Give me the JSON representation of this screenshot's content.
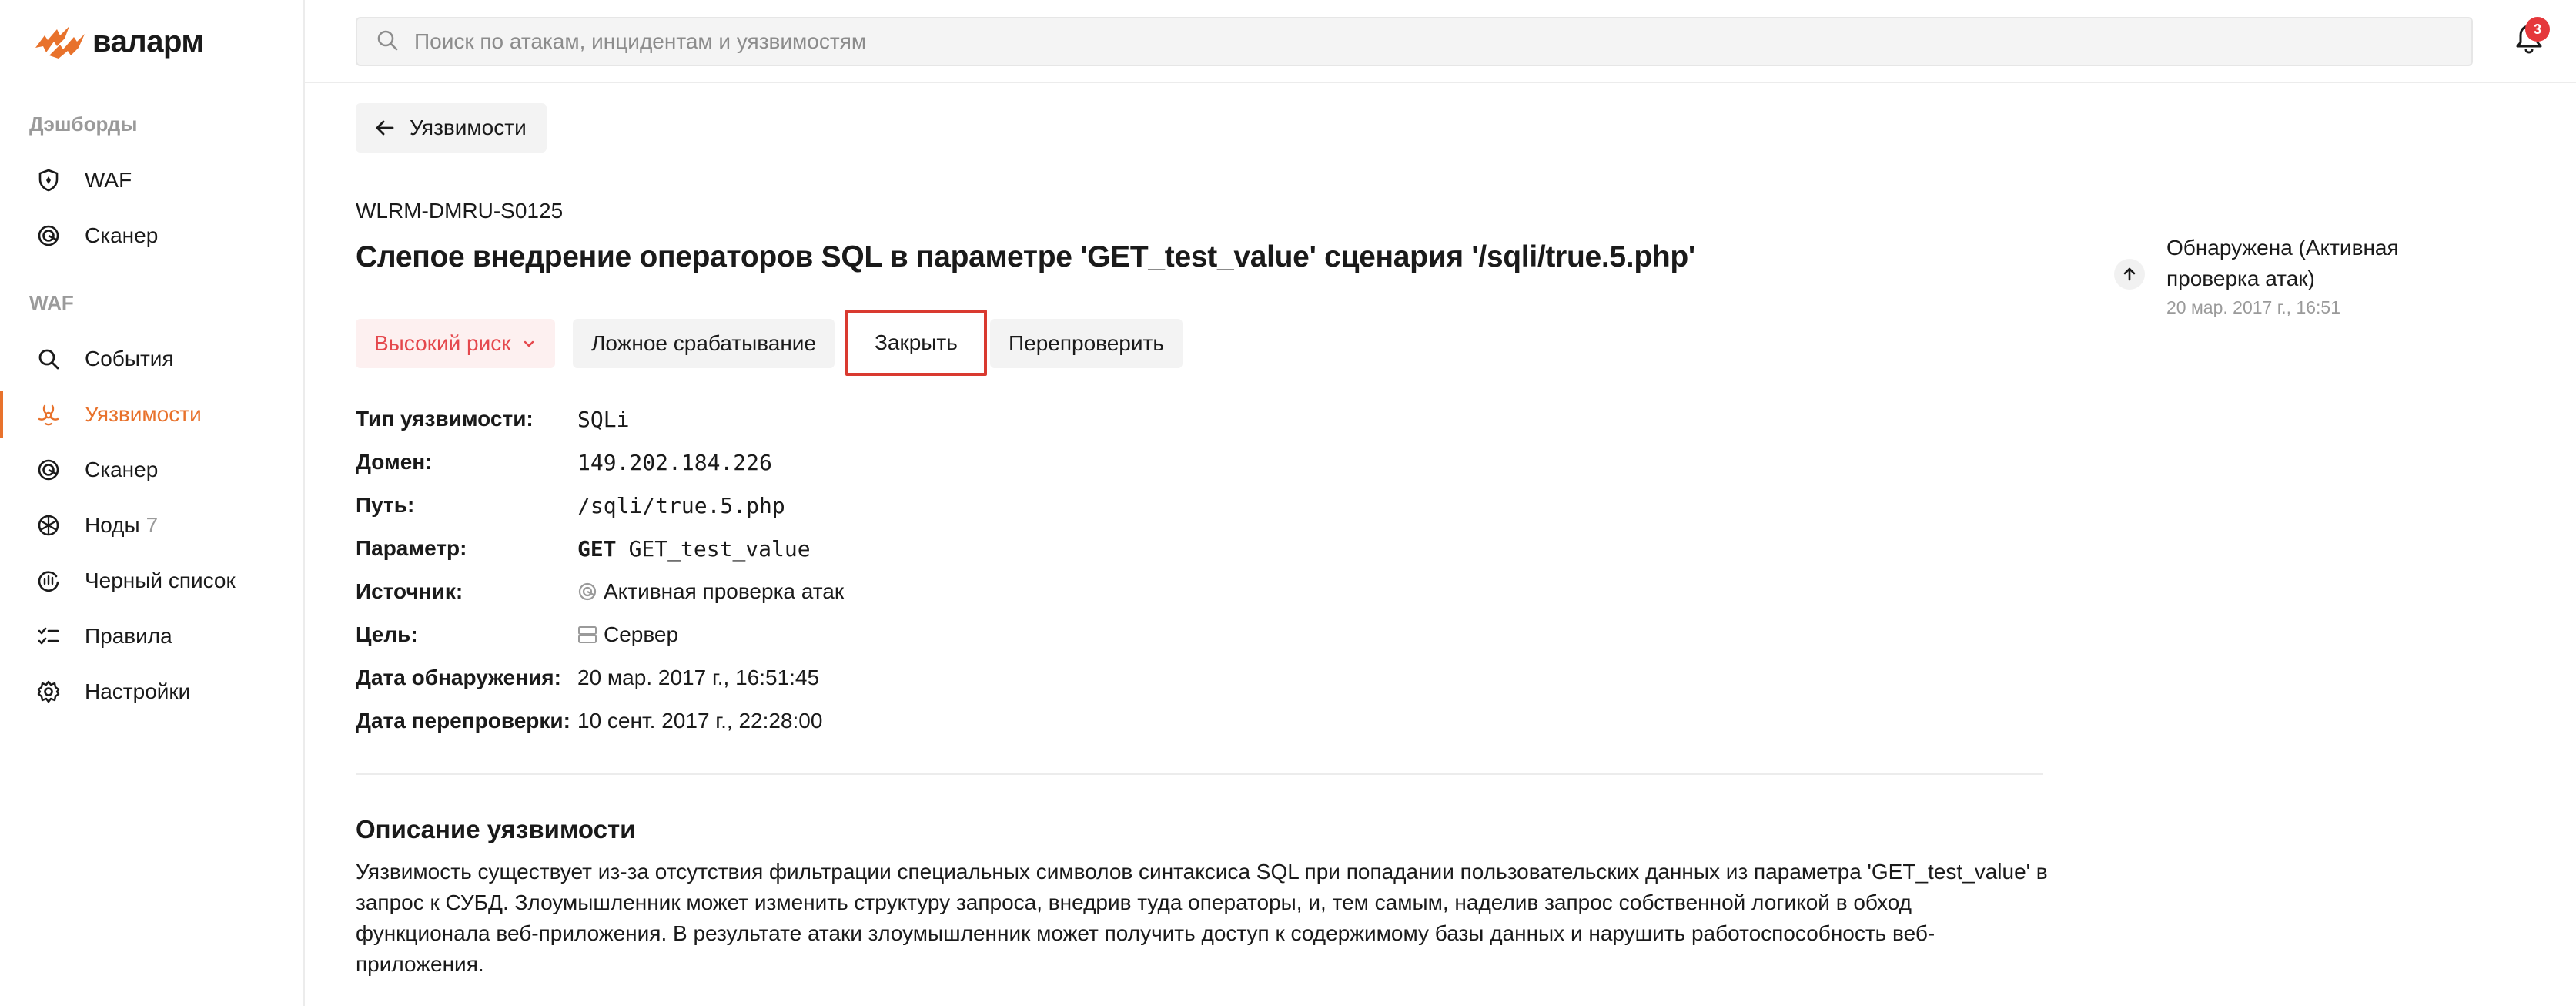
{
  "logo": {
    "text": "валарм"
  },
  "search": {
    "placeholder": "Поиск по атакам, инцидентам и уязвимостям"
  },
  "notifications": {
    "count": "3"
  },
  "sidebar": {
    "sections": [
      {
        "title": "Дэшборды"
      },
      {
        "title": "WAF"
      }
    ],
    "dashboards": [
      {
        "label": "WAF",
        "icon": "shield-icon"
      },
      {
        "label": "Сканер",
        "icon": "scanner-icon"
      }
    ],
    "waf": [
      {
        "label": "События",
        "icon": "search-icon"
      },
      {
        "label": "Уязвимости",
        "icon": "biohazard-icon",
        "active": true
      },
      {
        "label": "Сканер",
        "icon": "scanner-icon"
      },
      {
        "label": "Ноды",
        "icon": "nodes-icon",
        "count": "7"
      },
      {
        "label": "Черный список",
        "icon": "blacklist-icon"
      },
      {
        "label": "Правила",
        "icon": "rules-icon"
      },
      {
        "label": "Настройки",
        "icon": "gear-icon"
      }
    ]
  },
  "main": {
    "back_label": "Уязвимости",
    "vuln_id": "WLRM-DMRU-S0125",
    "title": "Слепое внедрение операторов SQL в параметре 'GET_test_value' сценария '/sqli/true.5.php'",
    "actions": {
      "risk": "Высокий риск",
      "false_positive": "Ложное срабатывание",
      "close": "Закрыть",
      "recheck": "Перепроверить"
    },
    "details": {
      "type_label": "Тип уязвимости:",
      "type_value": "SQLi",
      "domain_label": "Домен:",
      "domain_value": "149.202.184.226",
      "path_label": "Путь:",
      "path_value": "/sqli/true.5.php",
      "param_label": "Параметр:",
      "param_method": "GET",
      "param_value": "GET_test_value",
      "source_label": "Источник:",
      "source_value": "Активная проверка атак",
      "target_label": "Цель:",
      "target_value": "Сервер",
      "found_label": "Дата обнаружения:",
      "found_value": "20 мар. 2017 г., 16:51:45",
      "recheck_label": "Дата перепроверки:",
      "recheck_value": "10 сент. 2017 г., 22:28:00"
    },
    "description": {
      "title": "Описание уязвимости",
      "text": "Уязвимость существует из-за отсутствия фильтрации специальных символов синтаксиса SQL при попадании пользовательских данных из параметра 'GET_test_value' в запрос к СУБД. Злоумышленник может изменить структуру запроса, внедрив туда операторы, и, тем самым, наделив запрос собственной логикой в обход функционала веб-приложения. В результате атаки злоумышленник может получить доступ к содержимому базы данных и нарушить работоспособность веб-приложения."
    }
  },
  "status_timeline": {
    "status": "Обнаружена (Активная проверка атак)",
    "date": "20 мар. 2017 г., 16:51"
  },
  "colors": {
    "accent": "#e8722c",
    "risk": "#e5484d",
    "highlight_border": "#d93a30",
    "badge": "#e5383b"
  }
}
